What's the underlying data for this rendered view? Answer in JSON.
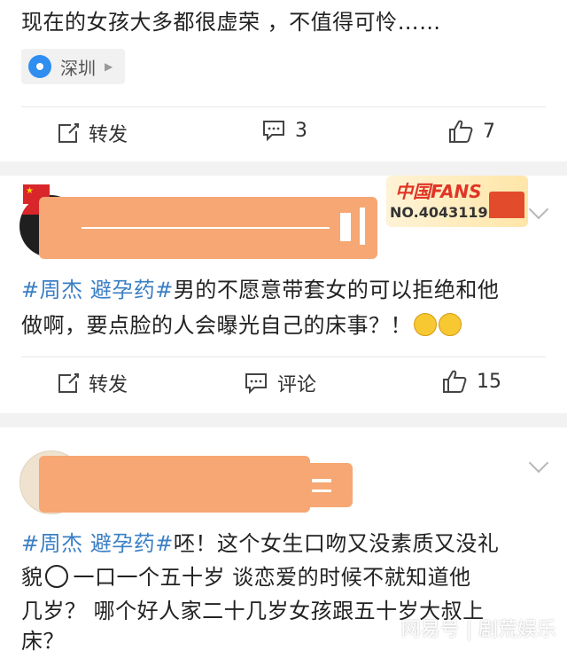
{
  "post1": {
    "text": "现在的女孩大多都很虚荣 ，不值得可怜……",
    "location": "深圳",
    "repost_label": "转发",
    "comment_count": "3",
    "like_count": "7"
  },
  "post2": {
    "badge_title": "中国FANS",
    "badge_number": "NO.4043119",
    "topic": "#周杰 避孕药#",
    "text_line1_rest": "男的不愿意带套女的可以拒绝和他",
    "text_line2": "做啊，要点脸的人会曝光自己的床事？！",
    "repost_label": "转发",
    "comment_label": "评论",
    "like_count": "15"
  },
  "post3": {
    "topic": "#周杰 避孕药#",
    "line1_rest": "呸！这个女生口吻又没素质又没礼",
    "line2_a": "貌",
    "line2_b": "一口一个五十岁 谈恋爱的时候不就知道他",
    "line3": "几岁？ 哪个好人家二十几岁女孩跟五十岁大叔上",
    "line4": "床？"
  },
  "watermark": "网易号 | 剧荒娱乐",
  "colors": {
    "topic": "#3b7fc4",
    "redaction": "#f6a773",
    "location_pin": "#2f8ef0"
  }
}
